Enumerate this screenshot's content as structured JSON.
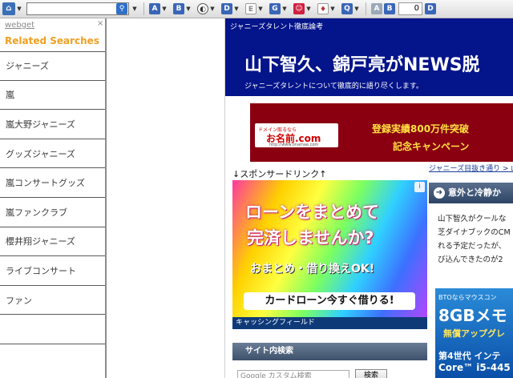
{
  "toolbar": {
    "search_value": "",
    "buttons": [
      "A",
      "B",
      "D",
      "G",
      "Q",
      "B"
    ],
    "counter": "0",
    "last_label": "D"
  },
  "sidebar": {
    "webget_label": "webget",
    "close_label": "×",
    "title": "Related Searches",
    "items": [
      {
        "label": "ジャニーズ"
      },
      {
        "label": "嵐"
      },
      {
        "label": "嵐大野ジャニーズ"
      },
      {
        "label": "グッズジャニーズ"
      },
      {
        "label": "嵐コンサートグッズ"
      },
      {
        "label": "嵐ファンクラブ"
      },
      {
        "label": "櫻井翔ジャニーズ"
      },
      {
        "label": "ライブコンサート"
      },
      {
        "label": "ファン"
      },
      {
        "label": ""
      }
    ]
  },
  "page": {
    "banner_sub": "ジャニーズタレント徹底論考",
    "banner_title": "山下智久、錦戸亮がNEWS脱",
    "banner_desc": "ジャニーズタレントについて徹底的に語り尽くします。",
    "onamae_ad": {
      "logo_top": "ドメイン取るなら",
      "logo_main": "お名前.com",
      "logo_url": "http://www.onamae.com",
      "line1": "登録実績800万件突破",
      "line2": "記念キャンペーン"
    },
    "sponsor_label": "↓スポンサードリンク↑",
    "breadcrumb": "ジャニーズ目抜き通り > 山",
    "loan_ad": {
      "info": "i",
      "line1": "ローンをまとめて",
      "line2": "完済しませんか?",
      "line3": "おまとめ・借り換えOK!",
      "button": "カードローン今すぐ借りる!",
      "footer": "キャッシングフィールド"
    },
    "site_search": {
      "heading": "サイト内検索",
      "placeholder": "Google カスタム検索",
      "button": "検索"
    },
    "side_heading": "意外と冷静か",
    "side_text": [
      "山下智久がクールな",
      "芝ダイナブックのCM",
      "れる予定だったが、",
      "び込んできたのが2"
    ],
    "bto_ad": {
      "t1": "BTOならマウスコン",
      "t2": "8GBメモ",
      "t3": "無償アップグレ",
      "t4": "第4世代 インテ",
      "t5": "Core™ i5-445"
    }
  }
}
